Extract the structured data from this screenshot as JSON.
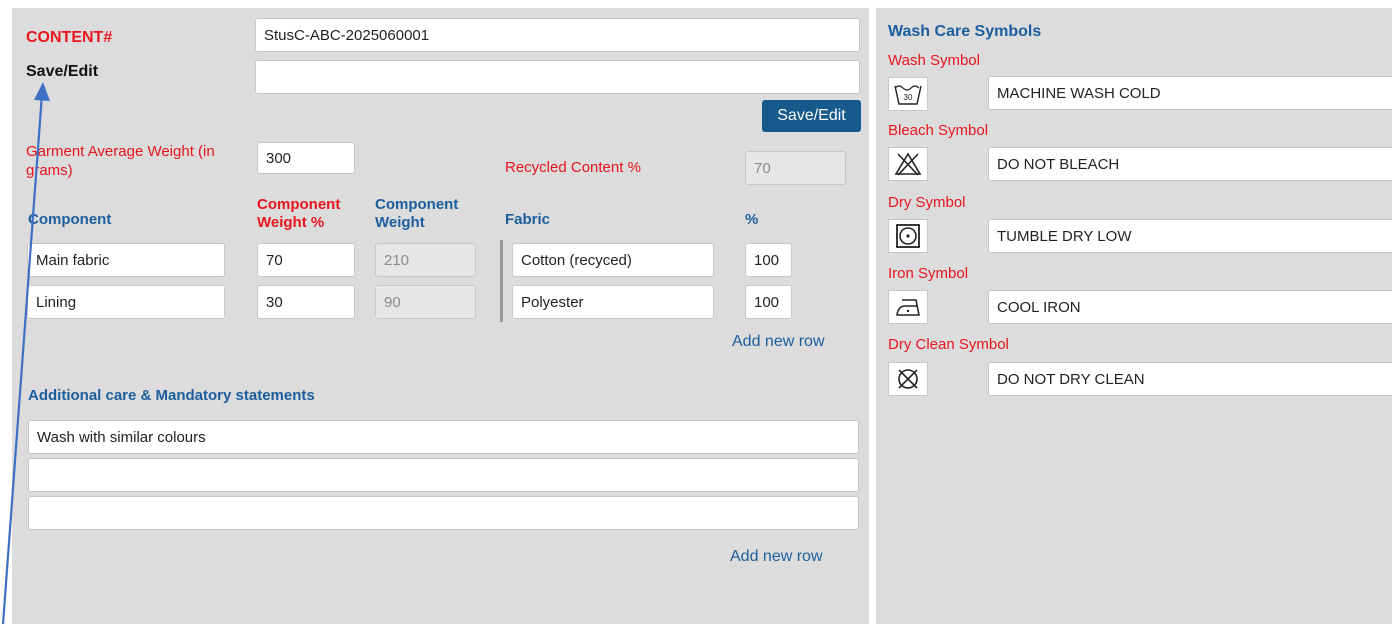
{
  "header": {
    "content_label": "CONTENT#",
    "content_value": "StusC-ABC-2025060001",
    "save_edit_label": "Save/Edit",
    "save_edit_value": "",
    "save_edit_button": "Save/Edit"
  },
  "weight": {
    "label": "Garment Average Weight (in grams)",
    "value": "300"
  },
  "recycled": {
    "label": "Recycled Content %",
    "value": "70"
  },
  "components": {
    "headers": {
      "component": "Component",
      "weight_pct": "Component Weight %",
      "weight": "Component Weight"
    },
    "rows": [
      {
        "name": "Main fabric",
        "weight_pct": "70",
        "weight": "210"
      },
      {
        "name": "Lining",
        "weight_pct": "30",
        "weight": "90"
      }
    ]
  },
  "fabrics": {
    "headers": {
      "fabric": "Fabric",
      "pct": "%"
    },
    "rows": [
      {
        "name": "Cotton (recyced)",
        "pct": "100"
      },
      {
        "name": "Polyester",
        "pct": "100"
      }
    ],
    "add_row": "Add new row"
  },
  "additional": {
    "title": "Additional care & Mandatory statements",
    "lines": [
      "Wash with similar colours",
      "",
      ""
    ],
    "add_row": "Add new row"
  },
  "wash_care": {
    "title": "Wash Care Symbols",
    "symbols": [
      {
        "label": "Wash Symbol",
        "icon": "wash-30-icon",
        "value": "MACHINE WASH COLD"
      },
      {
        "label": "Bleach Symbol",
        "icon": "do-not-bleach-icon",
        "value": "DO NOT BLEACH"
      },
      {
        "label": "Dry Symbol",
        "icon": "tumble-dry-low-icon",
        "value": "TUMBLE DRY LOW"
      },
      {
        "label": "Iron Symbol",
        "icon": "cool-iron-icon",
        "value": "COOL IRON"
      },
      {
        "label": "Dry Clean Symbol",
        "icon": "do-not-dry-clean-icon",
        "value": "DO NOT DRY CLEAN"
      }
    ]
  },
  "colors": {
    "accent_blue": "#1b5e9e",
    "label_red": "#e8141e",
    "button_bg": "#155a8a",
    "arrow": "#3d6fc4"
  }
}
